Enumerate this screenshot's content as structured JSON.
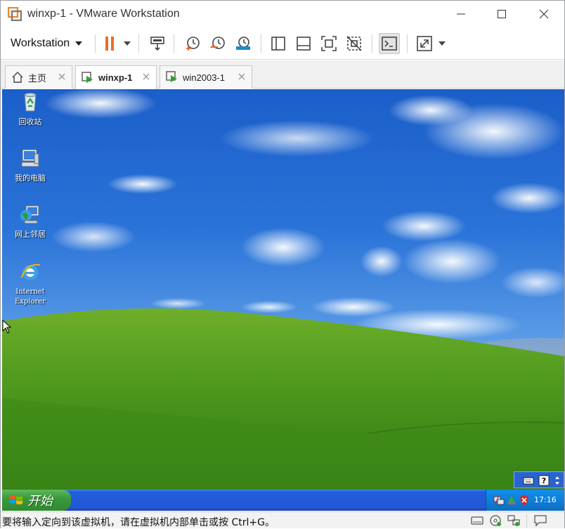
{
  "window": {
    "title": "winxp-1 - VMware Workstation"
  },
  "toolbar": {
    "menu_label": "Workstation",
    "buttons": [
      "pause-icon",
      "send-ctrl-alt-del-icon",
      "snapshot-icon",
      "revert-snapshot-icon",
      "snapshot-manager-icon",
      "show-library-icon",
      "thumbnail-bar-icon",
      "full-screen-icon",
      "unity-icon",
      "console-view-icon",
      "stretch-guest-icon"
    ]
  },
  "tabs": [
    {
      "label": "主页",
      "icon": "home-icon"
    },
    {
      "label": "winxp-1",
      "icon": "vm-running-icon",
      "active": true
    },
    {
      "label": "win2003-1",
      "icon": "vm-running-icon"
    }
  ],
  "desktop": {
    "icons": [
      {
        "label": "回收站",
        "icon": "recycle-bin-icon"
      },
      {
        "label": "我的电脑",
        "icon": "my-computer-icon"
      },
      {
        "label": "网上邻居",
        "icon": "network-places-icon"
      },
      {
        "label_line1": "Internet",
        "label_line2": "Explorer",
        "icon": "internet-explorer-icon"
      }
    ]
  },
  "taskbar": {
    "start_label": "开始",
    "clock": "17:16"
  },
  "status": {
    "text": "要将输入定向到该虚拟机，请在虚拟机内部单击或按 Ctrl+G。"
  },
  "colors": {
    "accent_orange": "#ef6c2a",
    "taskbar_blue": "#245edb",
    "start_green": "#3c9a3c"
  }
}
